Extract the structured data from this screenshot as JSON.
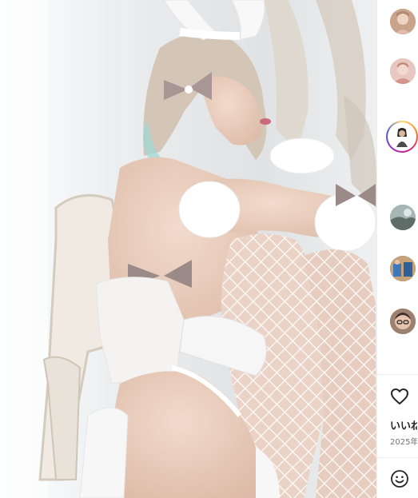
{
  "post": {
    "likes_label": "いいね",
    "date_label": "2025年"
  },
  "sidebar": {
    "comment_avatars": [
      {
        "name": "commenter-avatar-1",
        "tone": "#c9a38a"
      },
      {
        "name": "commenter-avatar-2",
        "tone": "#d7a9a0"
      },
      {
        "name": "commenter-avatar-3",
        "tone": "#2b2b2b"
      },
      {
        "name": "commenter-avatar-4",
        "tone": "#7d8c86"
      },
      {
        "name": "commenter-avatar-5",
        "tone": "#4f7db0"
      },
      {
        "name": "commenter-avatar-6",
        "tone": "#8a6a5a"
      }
    ]
  },
  "icons": {
    "like": "heart-icon",
    "emoji": "emoji-icon"
  },
  "colors": {
    "story_ring": [
      "#feda75",
      "#fa7e1e",
      "#d62976",
      "#962fbf",
      "#4f5bd5"
    ],
    "text_primary": "#262626",
    "text_secondary": "#737373"
  }
}
